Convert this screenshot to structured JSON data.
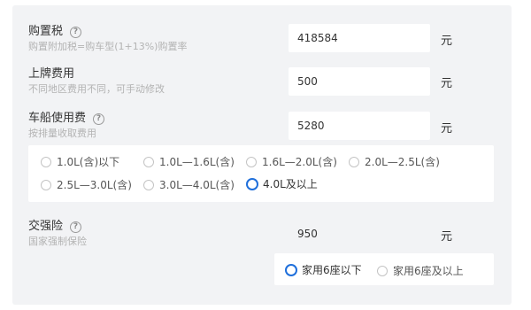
{
  "purchase_tax": {
    "title": "购置税",
    "subtitle": "购置附加税=购车型(1+13%)购置率",
    "value": "418584",
    "unit": "元"
  },
  "license_fee": {
    "title": "上牌费用",
    "subtitle": "不同地区费用不同，可手动修改",
    "value": "500",
    "unit": "元"
  },
  "vehicle_tax": {
    "title": "车船使用费",
    "subtitle": "按排量收取费用",
    "value": "5280",
    "unit": "元",
    "options": [
      "1.0L(含)以下",
      "1.0L—1.6L(含)",
      "1.6L—2.0L(含)",
      "2.0L—2.5L(含)",
      "2.5L—3.0L(含)",
      "3.0L—4.0L(含)",
      "4.0L及以上"
    ],
    "selected": "4.0L及以上"
  },
  "insurance": {
    "title": "交强险",
    "subtitle": "国家强制保险",
    "value": "950",
    "unit": "元",
    "options": [
      "家用6座以下",
      "家用6座及以上"
    ],
    "selected": "家用6座以下"
  },
  "help_icon": "question-circle-icon",
  "colors": {
    "panel_bg": "#f2f3f5",
    "accent": "#1f6fdb",
    "subtext": "#b3b3b3"
  }
}
